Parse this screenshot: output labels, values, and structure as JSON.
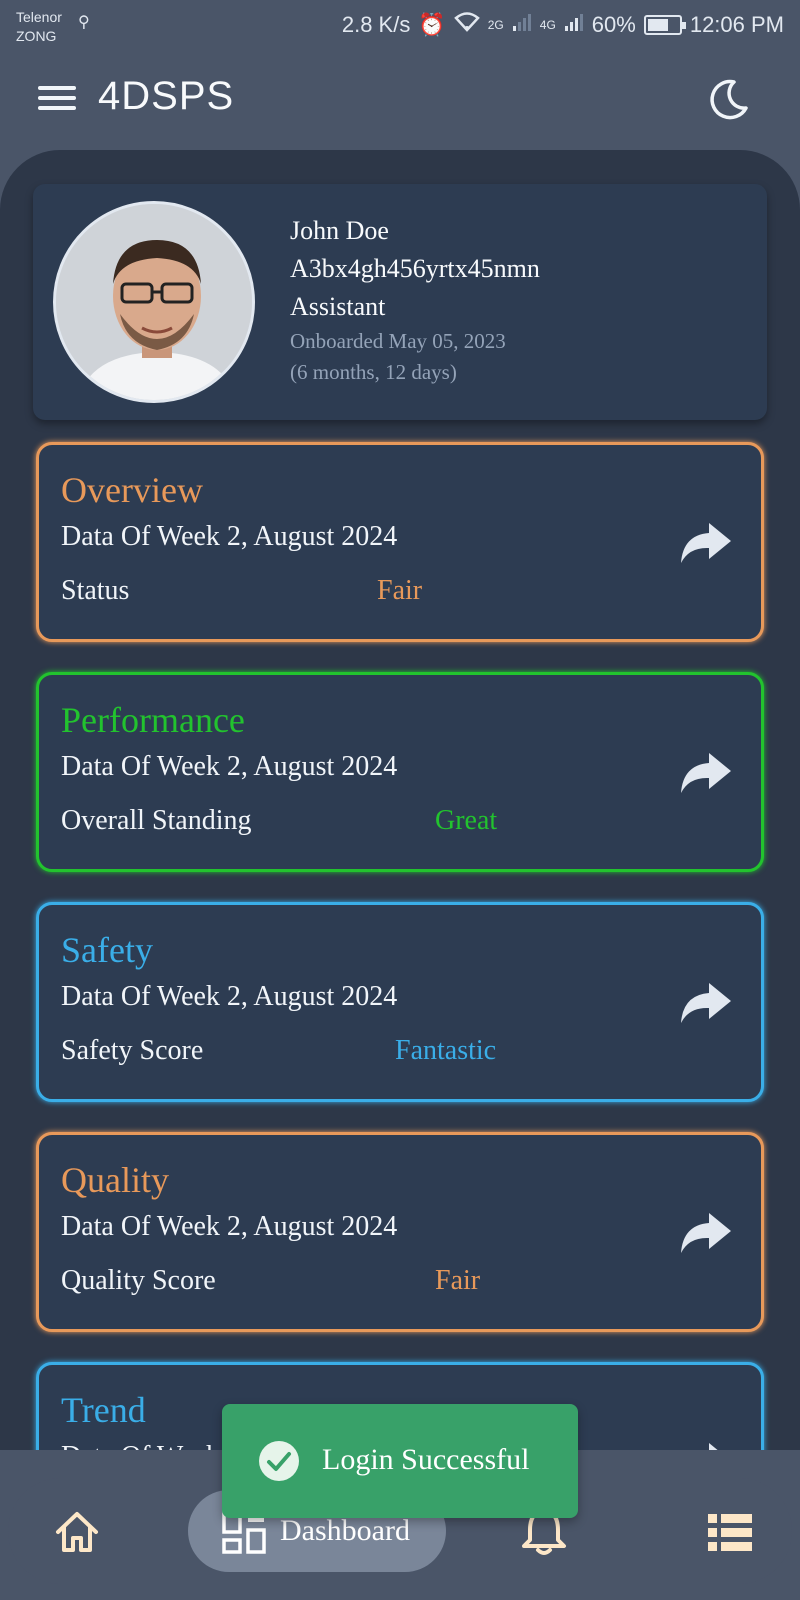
{
  "status_bar": {
    "carrier1": "Telenor",
    "carrier2": "ZONG",
    "speed": "2.8 K/s",
    "net1": "2G",
    "net2": "4G",
    "battery": "60%",
    "time": "12:06 PM"
  },
  "app_bar": {
    "title": "4DSPS"
  },
  "profile": {
    "name": "John Doe",
    "id": "A3bx4gh456yrtx45nmn",
    "role": "Assistant",
    "onboarded": "Onboarded May 05, 2023",
    "tenure": "(6 months, 12 days)"
  },
  "cards": [
    {
      "title": "Overview",
      "subtitle": "Data Of Week 2, August 2024",
      "label": "Status",
      "value": "Fair",
      "color": "#e8995a"
    },
    {
      "title": "Performance",
      "subtitle": "Data Of Week 2, August 2024",
      "label": "Overall Standing",
      "value": "Great",
      "color": "#22c32e"
    },
    {
      "title": "Safety",
      "subtitle": "Data Of Week 2, August 2024",
      "label": "Safety Score",
      "value": "Fantastic",
      "color": "#3aaee8"
    },
    {
      "title": "Quality",
      "subtitle": "Data Of Week 2, August 2024",
      "label": "Quality Score",
      "value": "Fair",
      "color": "#e8995a"
    },
    {
      "title": "Trend",
      "subtitle": "Data Of Week 2, August 2024",
      "color": "#3aaee8"
    }
  ],
  "toast": {
    "message": "Login Successful",
    "icon": "check-circle-icon"
  },
  "bottom_nav": {
    "dashboard_label": "Dashboard",
    "icons": [
      "home-icon",
      "dashboard-icon",
      "bell-icon",
      "list-icon"
    ]
  },
  "colors": {
    "background": "#4a5568",
    "panel": "#2d3748",
    "card": "#2d3c52",
    "toast": "#38a169"
  }
}
